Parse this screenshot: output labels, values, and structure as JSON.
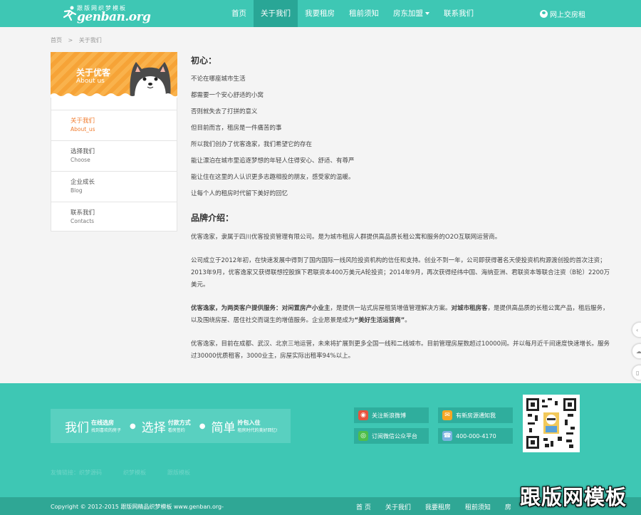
{
  "header": {
    "logo_sub": "跟版网织梦模板",
    "logo_main": "genban.org",
    "nav": [
      {
        "label": "首页"
      },
      {
        "label": "关于我们"
      },
      {
        "label": "我要租房"
      },
      {
        "label": "租前须知"
      },
      {
        "label": "房东加盟"
      },
      {
        "label": "联系我们"
      }
    ],
    "login_label": "网上交房租"
  },
  "breadcrumb": {
    "home": "首页",
    "sep": ">",
    "current": "关于我们"
  },
  "sidebar": {
    "banner_title": "关于优客",
    "banner_sub": "About us",
    "items": [
      {
        "cn": "关于我们",
        "en": "About_us"
      },
      {
        "cn": "选择我们",
        "en": "Choose"
      },
      {
        "cn": "企业成长",
        "en": "Blog"
      },
      {
        "cn": "联系我们",
        "en": "Contacts"
      }
    ]
  },
  "content": {
    "heading1": "初心：",
    "lines": [
      "不论在哪座城市生活",
      "都需要一个安心舒适的小窝",
      "否则就失去了打拼的意义",
      "但目前而言，租房是一件痛苦的事",
      "所以我们创办了优客逸家，我们希望它的存在",
      "能让漂泊在城市里追逐梦想的年轻人住得安心、舒适、有尊严",
      "能让住在这里的人认识更多志趣相投的朋友，感受家的温暖。",
      "让每个人的租房时代留下美好的回忆"
    ],
    "heading2": "品牌介绍：",
    "para1": "优客逸家，隶属于四川优客投资管理有限公司。是为城市租房人群提供高品质长租公寓和服务的O2O互联网运营商。",
    "para2": "公司成立于2012年初，在快速发展中得到了国内国际一线风险投资机构的信任和支持。创业不到一年，公司即获得著名天使投资机构源渡创投的首次注资；2013年9月，优客逸家又获得联想控股旗下君联资本400万美元A轮投资；2014年9月，再次获得经纬中国、海纳亚洲、君联资本等联合注资（B轮）2200万美元。",
    "para3": {
      "b1": "优客逸家，为两类客户提供服务：对闲置房产小业主",
      "t1": "，是提供一站式房屋租赁增值管理解决方案。",
      "b2": "对城市租房客",
      "t2": "，是提供高品质的长租公寓产品，租后服务，以及围绕房屋、居住社交而诞生的增值服务。企业愿景是成为",
      "b3": "“美好生活运营商”",
      "t3": "。"
    },
    "para4": "优客逸家，目前在成都、武汉、北京三地运营，未来将扩展到更多全国一线和二线城市。目前管理房屋数超过10000间。并以每月近千间速度快速增长。服务过30000优质租客，3000业主，房屋实际出租率94%以上。"
  },
  "footer": {
    "slogan": [
      {
        "big": "我们",
        "small_b": "在线选房",
        "small_s": "找到喜欢的房子"
      },
      {
        "big": "选择",
        "small_b": "付款方式",
        "small_s": "看房签约"
      },
      {
        "big": "简单",
        "small_b": "拎包入住",
        "small_s": "租房时代的美好回忆!"
      }
    ],
    "social": [
      {
        "label": "关注新浪微博",
        "icon": "weibo-icon",
        "color": "#e8533f"
      },
      {
        "label": "有新房源通知我",
        "icon": "mail-icon",
        "color": "#f5a623"
      },
      {
        "label": "订阅微信公众平台",
        "icon": "wechat-icon",
        "color": "#4fbf4a"
      },
      {
        "label": "400-000-4170",
        "icon": "phone-icon",
        "color": "#7ab3e0"
      }
    ],
    "friend_links": [
      "友情链接：织梦源码",
      "织梦模板",
      "跟版模板"
    ],
    "copyright": "Copyright © 2012-2015 跟版网精品织梦模板 www.genban.org-",
    "bottom_nav": [
      "首 页",
      "关于我们",
      "我要租房",
      "租前须知",
      "房"
    ],
    "watermark": "跟版网模板"
  },
  "colors": {
    "primary": "#3ec7b4",
    "accent": "#f17b2d",
    "banner": "#f6a337"
  }
}
